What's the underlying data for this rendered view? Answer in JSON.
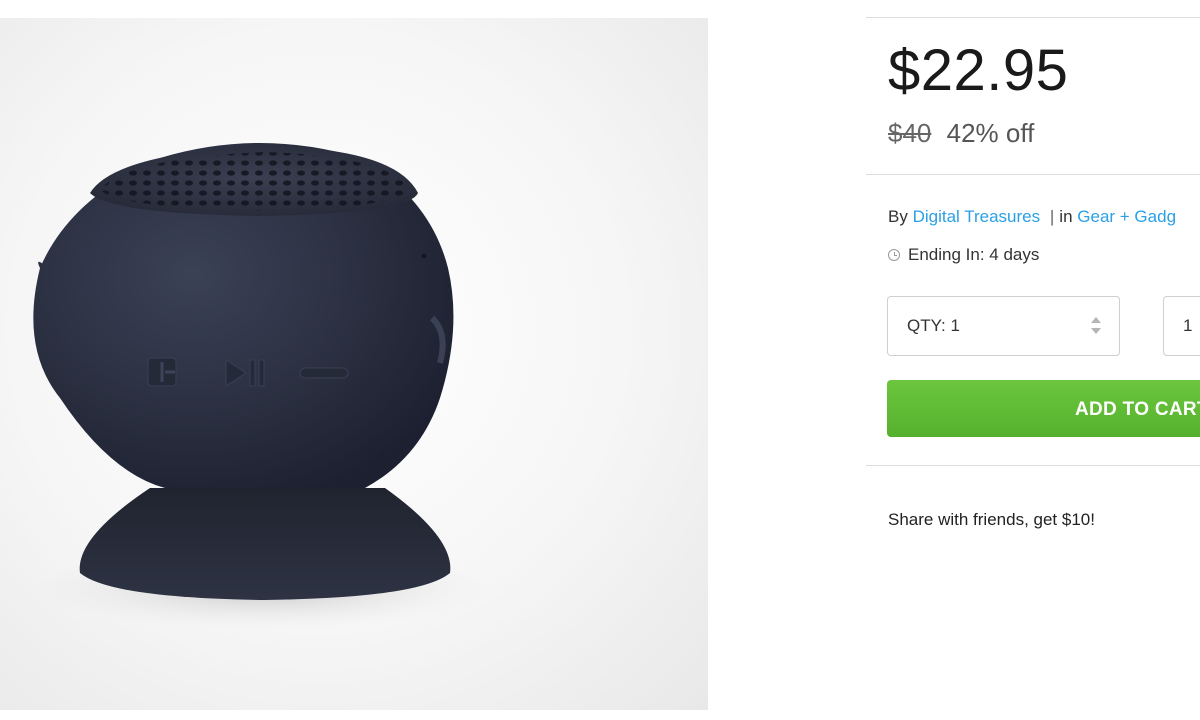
{
  "product": {
    "image_alt": "Bluetooth suction-cup speaker",
    "price": "$22.95",
    "original_price": "$40",
    "discount": "42% off",
    "by_label": "By",
    "seller": "Digital Treasures",
    "separator": "|",
    "in_label": "in",
    "category": "Gear + Gadg",
    "ending_text": "Ending In: 4 days",
    "quantity_label": "QTY: 1",
    "second_select_value": "1",
    "add_to_cart": "ADD TO CART",
    "share_text": "Share with friends, get $10!"
  },
  "colors": {
    "link": "#2aa0e6",
    "cart_button": "#5cb833",
    "speaker_body": "#2c3142"
  },
  "icons": [
    "clock-icon",
    "spinner-arrows-icon"
  ]
}
